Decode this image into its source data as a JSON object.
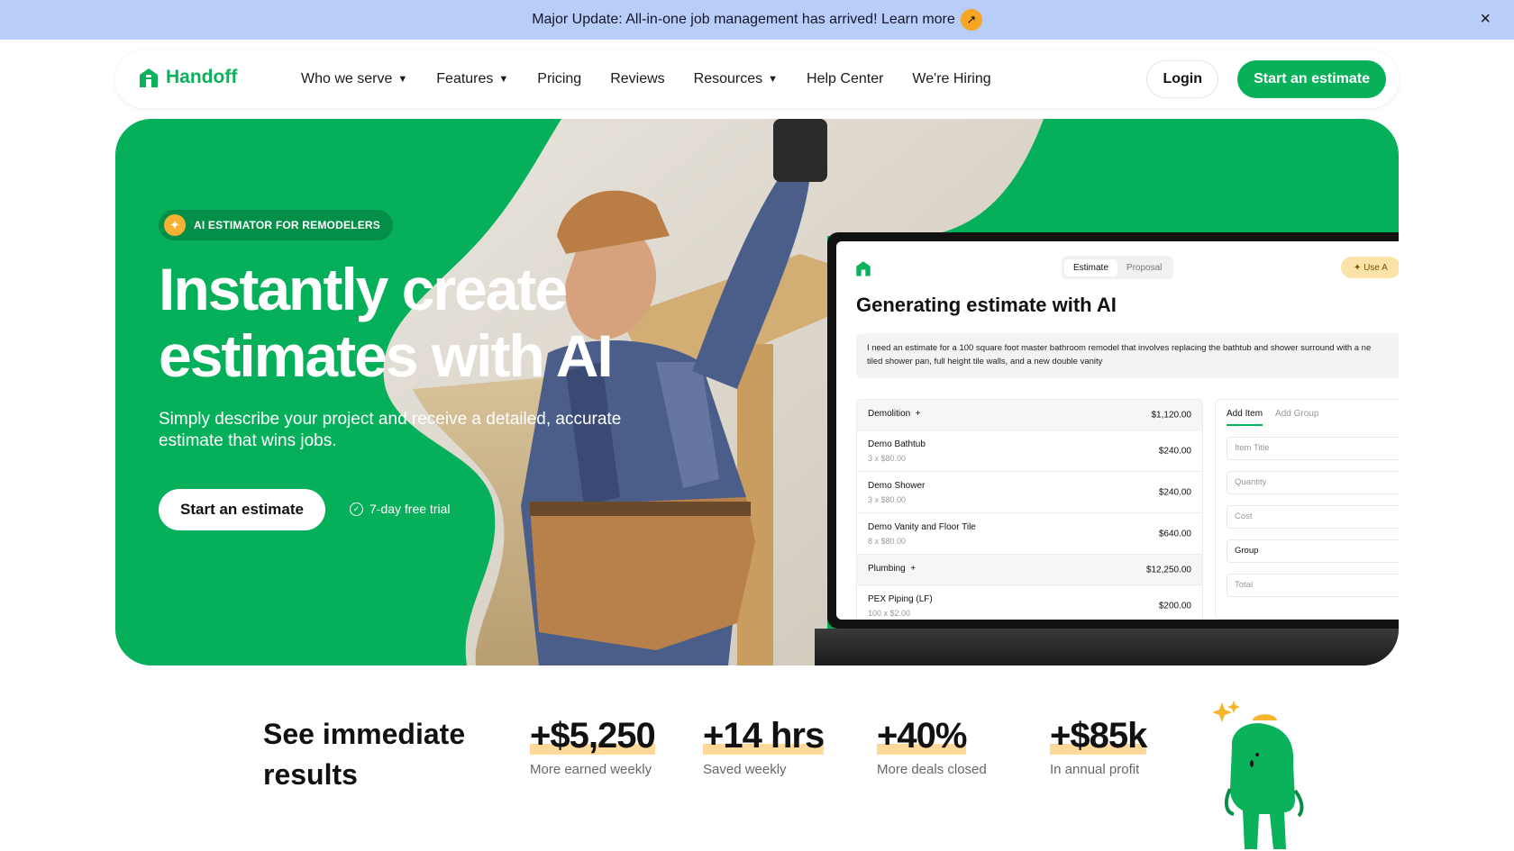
{
  "announcement": {
    "text": "Major Update: All-in-one job management has arrived! Learn more",
    "arrow_icon": "arrow-up-right-icon",
    "close_icon": "close-icon"
  },
  "nav": {
    "logo_text": "Handoff",
    "links": [
      {
        "label": "Who we serve",
        "has_dropdown": true
      },
      {
        "label": "Features",
        "has_dropdown": true
      },
      {
        "label": "Pricing",
        "has_dropdown": false
      },
      {
        "label": "Reviews",
        "has_dropdown": false
      },
      {
        "label": "Resources",
        "has_dropdown": true
      },
      {
        "label": "Help Center",
        "has_dropdown": false
      },
      {
        "label": "We're Hiring",
        "has_dropdown": false
      }
    ],
    "login_label": "Login",
    "cta_label": "Start an estimate"
  },
  "hero": {
    "badge": "AI ESTIMATOR FOR REMODELERS",
    "title_line1": "Instantly create",
    "title_line2": "estimates with AI",
    "subtitle": "Simply describe your project and receive a detailed, accurate estimate that wins jobs.",
    "cta_label": "Start an estimate",
    "trial_label": "7-day free trial"
  },
  "mockup": {
    "tabs": [
      "Estimate",
      "Proposal"
    ],
    "use_ai_label": "Use A",
    "title": "Generating estimate with AI",
    "prompt_line1": "I need an estimate for a 100 square foot master bathroom remodel that involves replacing the bathtub and shower surround with a ne",
    "prompt_line2": "tiled shower pan, full height tile walls, and a new double vanity",
    "groups": [
      {
        "name": "Demolition",
        "total": "$1,120.00",
        "items": [
          {
            "name": "Demo Bathtub",
            "qty": "3 x $80.00",
            "amount": "$240.00"
          },
          {
            "name": "Demo Shower",
            "qty": "3 x $80.00",
            "amount": "$240.00"
          },
          {
            "name": "Demo Vanity and Floor Tile",
            "qty": "8 x $80.00",
            "amount": "$640.00"
          }
        ]
      },
      {
        "name": "Plumbing",
        "total": "$12,250.00",
        "items": [
          {
            "name": "PEX Piping (LF)",
            "qty": "100 x $2.00",
            "amount": "$200.00"
          }
        ]
      }
    ],
    "side_tabs": [
      "Add Item",
      "Add Group"
    ],
    "fields": {
      "item_title": "Item Title",
      "quantity": "Quantity",
      "cost": "Cost",
      "group": "Group",
      "total": "Total",
      "currency": "$"
    }
  },
  "stats": {
    "title": "See immediate results",
    "items": [
      {
        "value": "+$5,250",
        "label": "More earned weekly"
      },
      {
        "value": "+14 hrs",
        "label": "Saved weekly"
      },
      {
        "value": "+40%",
        "label": "More deals closed"
      },
      {
        "value": "+$85k",
        "label": "In annual profit"
      }
    ]
  },
  "colors": {
    "brand_green": "#08b05a",
    "announcement_bg": "#b9cdf9",
    "accent_orange": "#f6a623",
    "highlight": "#ffd89a"
  }
}
